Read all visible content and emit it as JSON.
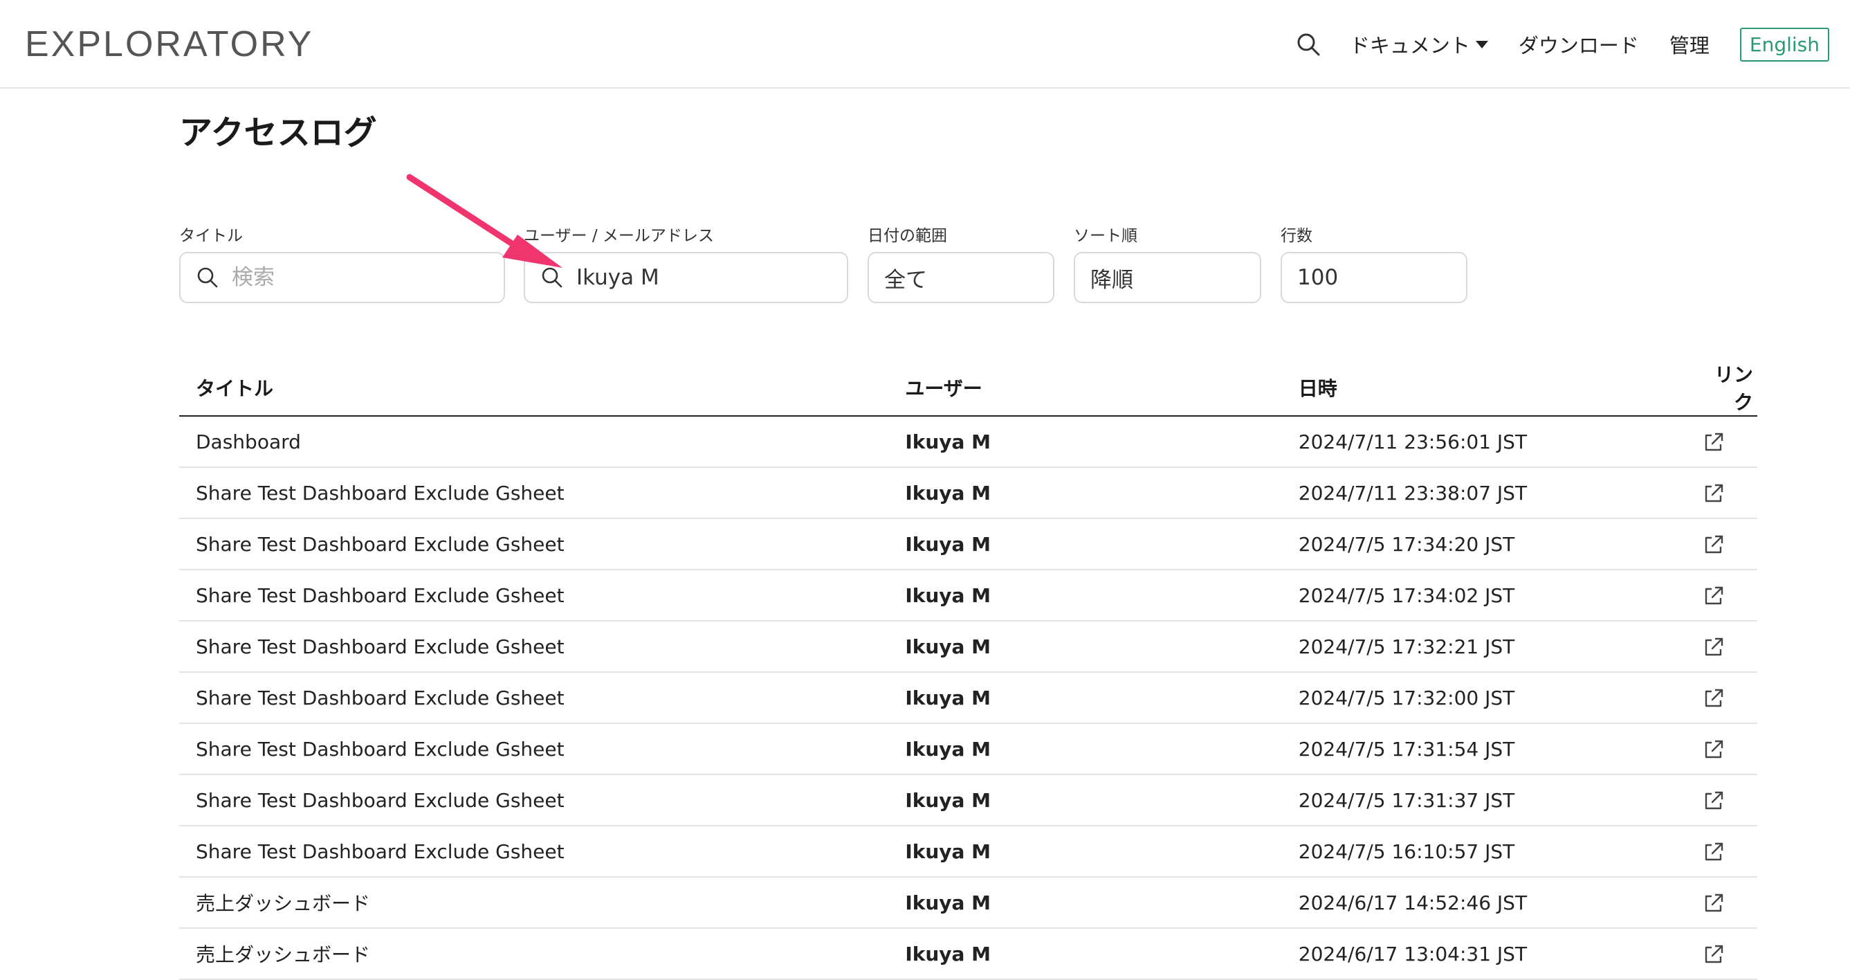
{
  "header": {
    "logo": "EXPLORATORY",
    "nav": {
      "documents": "ドキュメント",
      "download": "ダウンロード",
      "admin": "管理",
      "language": "English"
    },
    "accent_color": "#2a9a6f"
  },
  "page": {
    "title": "アクセスログ"
  },
  "filters": {
    "title": {
      "label": "タイトル",
      "placeholder": "検索",
      "value": ""
    },
    "user": {
      "label": "ユーザー / メールアドレス",
      "placeholder": "",
      "value": "Ikuya M"
    },
    "date_range": {
      "label": "日付の範囲",
      "value": "全て"
    },
    "sort": {
      "label": "ソート順",
      "value": "降順"
    },
    "rows": {
      "label": "行数",
      "value": "100"
    }
  },
  "table": {
    "headers": {
      "title": "タイトル",
      "user": "ユーザー",
      "date": "日時",
      "link": "リンク"
    },
    "rows": [
      {
        "title": "Dashboard",
        "user": "Ikuya M",
        "date": "2024/7/11 23:56:01 JST"
      },
      {
        "title": "Share Test Dashboard Exclude Gsheet",
        "user": "Ikuya M",
        "date": "2024/7/11 23:38:07 JST"
      },
      {
        "title": "Share Test Dashboard Exclude Gsheet",
        "user": "Ikuya M",
        "date": "2024/7/5 17:34:20 JST"
      },
      {
        "title": "Share Test Dashboard Exclude Gsheet",
        "user": "Ikuya M",
        "date": "2024/7/5 17:34:02 JST"
      },
      {
        "title": "Share Test Dashboard Exclude Gsheet",
        "user": "Ikuya M",
        "date": "2024/7/5 17:32:21 JST"
      },
      {
        "title": "Share Test Dashboard Exclude Gsheet",
        "user": "Ikuya M",
        "date": "2024/7/5 17:32:00 JST"
      },
      {
        "title": "Share Test Dashboard Exclude Gsheet",
        "user": "Ikuya M",
        "date": "2024/7/5 17:31:54 JST"
      },
      {
        "title": "Share Test Dashboard Exclude Gsheet",
        "user": "Ikuya M",
        "date": "2024/7/5 17:31:37 JST"
      },
      {
        "title": "Share Test Dashboard Exclude Gsheet",
        "user": "Ikuya M",
        "date": "2024/7/5 16:10:57 JST"
      },
      {
        "title": "売上ダッシュボード",
        "user": "Ikuya M",
        "date": "2024/6/17 14:52:46 JST"
      },
      {
        "title": "売上ダッシュボード",
        "user": "Ikuya M",
        "date": "2024/6/17 13:04:31 JST"
      }
    ]
  },
  "annotation": {
    "arrow_color": "#f0346e"
  }
}
